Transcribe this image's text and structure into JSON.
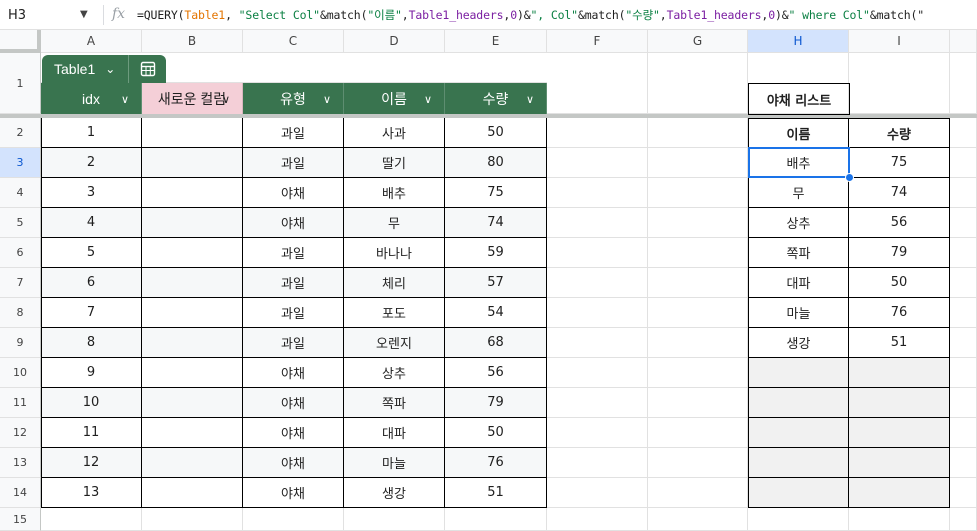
{
  "formula_bar": {
    "cell_ref": "H3",
    "fx_label": "fx",
    "formula_parts": [
      {
        "text": "=QUERY(",
        "kind": "plain"
      },
      {
        "text": "Table1",
        "kind": "table"
      },
      {
        "text": ", ",
        "kind": "plain"
      },
      {
        "text": "\"Select Col\"",
        "kind": "string"
      },
      {
        "text": "&match(",
        "kind": "plain"
      },
      {
        "text": "\"이름\"",
        "kind": "string"
      },
      {
        "text": ",",
        "kind": "plain"
      },
      {
        "text": "Table1_headers",
        "kind": "named"
      },
      {
        "text": ",",
        "kind": "plain"
      },
      {
        "text": "0",
        "kind": "named"
      },
      {
        "text": ")&",
        "kind": "plain"
      },
      {
        "text": "\", Col\"",
        "kind": "string"
      },
      {
        "text": "&match(",
        "kind": "plain"
      },
      {
        "text": "\"수량\"",
        "kind": "string"
      },
      {
        "text": ",",
        "kind": "plain"
      },
      {
        "text": "Table1_headers",
        "kind": "named"
      },
      {
        "text": ",",
        "kind": "plain"
      },
      {
        "text": "0",
        "kind": "named"
      },
      {
        "text": ")&",
        "kind": "plain"
      },
      {
        "text": "\" where Col\"",
        "kind": "string"
      },
      {
        "text": "&match(\"",
        "kind": "plain"
      }
    ]
  },
  "columns": [
    "A",
    "B",
    "C",
    "D",
    "E",
    "F",
    "G",
    "H",
    "I"
  ],
  "selected_column": "H",
  "rows": [
    "1",
    "2",
    "3",
    "4",
    "5",
    "6",
    "7",
    "8",
    "9",
    "10",
    "11",
    "12",
    "13",
    "14",
    "15"
  ],
  "selected_row": "3",
  "table": {
    "name": "Table1",
    "headers": [
      "idx",
      "새로운 컬럼",
      "유형",
      "이름",
      "수량"
    ],
    "rows": [
      [
        "1",
        "",
        "과일",
        "사과",
        "50"
      ],
      [
        "2",
        "",
        "과일",
        "딸기",
        "80"
      ],
      [
        "3",
        "",
        "야채",
        "배추",
        "75"
      ],
      [
        "4",
        "",
        "야채",
        "무",
        "74"
      ],
      [
        "5",
        "",
        "과일",
        "바나나",
        "59"
      ],
      [
        "6",
        "",
        "과일",
        "체리",
        "57"
      ],
      [
        "7",
        "",
        "과일",
        "포도",
        "54"
      ],
      [
        "8",
        "",
        "과일",
        "오렌지",
        "68"
      ],
      [
        "9",
        "",
        "야채",
        "상추",
        "56"
      ],
      [
        "10",
        "",
        "야채",
        "쪽파",
        "79"
      ],
      [
        "11",
        "",
        "야채",
        "대파",
        "50"
      ],
      [
        "12",
        "",
        "야채",
        "마늘",
        "76"
      ],
      [
        "13",
        "",
        "야채",
        "생강",
        "51"
      ]
    ]
  },
  "veg_list": {
    "title": "야채 리스트",
    "headers": [
      "이름",
      "수량"
    ],
    "rows": [
      [
        "배추",
        "75"
      ],
      [
        "무",
        "74"
      ],
      [
        "상추",
        "56"
      ],
      [
        "쪽파",
        "79"
      ],
      [
        "대파",
        "50"
      ],
      [
        "마늘",
        "76"
      ],
      [
        "생강",
        "51"
      ],
      [
        "",
        ""
      ],
      [
        "",
        ""
      ],
      [
        "",
        ""
      ],
      [
        "",
        ""
      ],
      [
        "",
        ""
      ]
    ]
  },
  "colors": {
    "table_header": "#39744f",
    "new_column_header": "#f4cfd7",
    "selection": "#1a73e8"
  }
}
